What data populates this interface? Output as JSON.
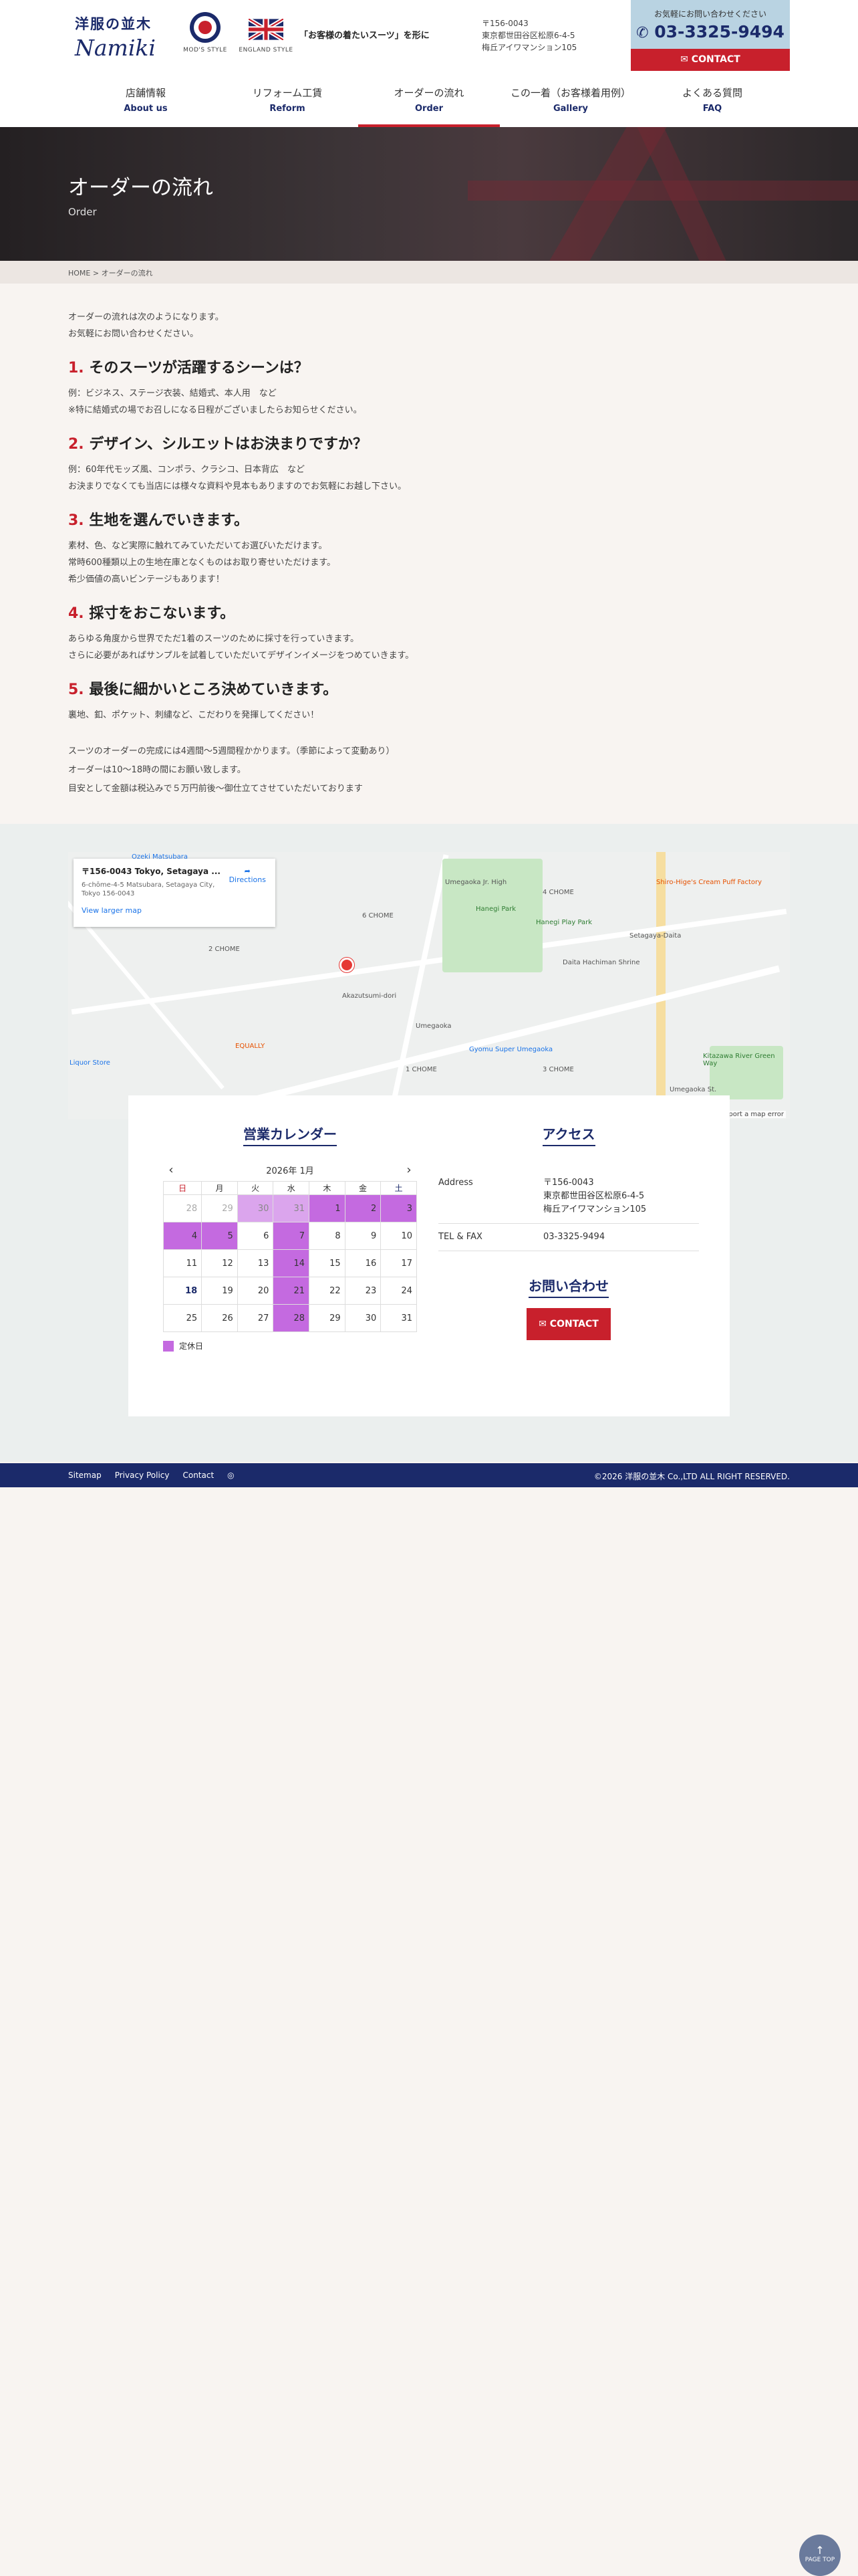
{
  "header": {
    "logo_jp": "洋服の並木",
    "logo_en": "Namiki",
    "mods_caption": "MOD'S STYLE",
    "england_caption": "ENGLAND STYLE",
    "tagline": "「お客様の着たいスーツ」を形に",
    "address_lines": [
      "〒156-0043",
      "東京都世田谷区松原6-4-5",
      "梅丘アイワマンション105"
    ],
    "contact_label": "お気軽にお問い合わせください",
    "phone": "03-3325-9494",
    "contact_button": "CONTACT"
  },
  "nav": [
    {
      "jp": "店舗情報",
      "en": "About us"
    },
    {
      "jp": "リフォーム工賃",
      "en": "Reform"
    },
    {
      "jp": "オーダーの流れ",
      "en": "Order"
    },
    {
      "jp": "この一着（お客様着用例）",
      "en": "Gallery"
    },
    {
      "jp": "よくある質問",
      "en": "FAQ"
    }
  ],
  "hero": {
    "title": "オーダーの流れ",
    "subtitle": "Order"
  },
  "breadcrumb": "HOME > オーダーの流れ",
  "intro": [
    "オーダーの流れは次のようになります。",
    "お気軽にお問い合わせください。"
  ],
  "steps": [
    {
      "num": "1.",
      "title": "そのスーツが活躍するシーンは？",
      "lines": [
        "例：ビジネス、ステージ衣装、結婚式、本人用　など",
        "※特に結婚式の場でお召しになる日程がございましたらお知らせください。"
      ]
    },
    {
      "num": "2.",
      "title": "デザイン、シルエットはお決まりですか？",
      "lines": [
        "例：60年代モッズ風、コンポラ、クラシコ、日本背広　など",
        "お決まりでなくても当店には様々な資料や見本もありますのでお気軽にお越し下さい。"
      ]
    },
    {
      "num": "3.",
      "title": "生地を選んでいきます。",
      "lines": [
        "素材、色、など実際に触れてみていただいてお選びいただけます。",
        "常時600種類以上の生地在庫となくものはお取り寄せいただけます。",
        "希少価値の高いビンテージもあります！"
      ]
    },
    {
      "num": "4.",
      "title": "採寸をおこないます。",
      "lines": [
        "あらゆる角度から世界でただ1着のスーツのために採寸を行っていきます。",
        "さらに必要があればサンプルを試着していただいてデザインイメージをつめていきます。"
      ]
    },
    {
      "num": "5.",
      "title": "最後に細かいところ決めていきます。",
      "lines": [
        "裏地、釦、ポケット、刺繍など、こだわりを発揮してください！"
      ]
    }
  ],
  "notes": [
    "スーツのオーダーの完成には4週間〜5週間程かかります。（季節によって変動あり）",
    "オーダーは10〜18時の間にお願い致します。",
    "目安として金額は税込みで５万円前後〜御仕立てさせていただいております"
  ],
  "map": {
    "card_title": "〒156-0043 Tokyo, Setagaya ...",
    "card_addr": "6-chōme-4-5 Matsubara, Setagaya City, Tokyo 156-0043",
    "directions": "Directions",
    "larger": "View larger map",
    "report": "Report a map error",
    "labels": [
      "Umegaoka Jr. High",
      "Hanegi Park",
      "Hanegi Play Park",
      "Setagaya-Daita",
      "Shiro-Hige's Cream Puff Factory",
      "Daita Hachiman Shrine",
      "Akazutsumi-dori",
      "Umegaoka",
      "Gyomu Super Umegaoka",
      "Kitazawa River Green Way",
      "EQUALLY",
      "Liquor Store",
      "Umegaoka St.",
      "6 CHOME",
      "2 CHOME",
      "4 CHOME",
      "1 CHOME",
      "3 CHOME",
      "Ozeki Matsubara"
    ]
  },
  "calendar": {
    "title": "営業カレンダー",
    "month": "2026年 1月",
    "weekdays": [
      "日",
      "月",
      "火",
      "水",
      "木",
      "金",
      "土"
    ],
    "weeks": [
      [
        {
          "d": "28",
          "o": true,
          "c": false
        },
        {
          "d": "29",
          "o": true,
          "c": false
        },
        {
          "d": "30",
          "o": true,
          "c": true
        },
        {
          "d": "31",
          "o": true,
          "c": true
        },
        {
          "d": "1",
          "o": false,
          "c": true
        },
        {
          "d": "2",
          "o": false,
          "c": true
        },
        {
          "d": "3",
          "o": false,
          "c": true
        }
      ],
      [
        {
          "d": "4",
          "o": false,
          "c": true
        },
        {
          "d": "5",
          "o": false,
          "c": true
        },
        {
          "d": "6",
          "o": false,
          "c": false
        },
        {
          "d": "7",
          "o": false,
          "c": true
        },
        {
          "d": "8",
          "o": false,
          "c": false
        },
        {
          "d": "9",
          "o": false,
          "c": false
        },
        {
          "d": "10",
          "o": false,
          "c": false
        }
      ],
      [
        {
          "d": "11",
          "o": false,
          "c": false
        },
        {
          "d": "12",
          "o": false,
          "c": false
        },
        {
          "d": "13",
          "o": false,
          "c": false
        },
        {
          "d": "14",
          "o": false,
          "c": true
        },
        {
          "d": "15",
          "o": false,
          "c": false
        },
        {
          "d": "16",
          "o": false,
          "c": false
        },
        {
          "d": "17",
          "o": false,
          "c": false
        }
      ],
      [
        {
          "d": "18",
          "o": false,
          "c": false,
          "t": true
        },
        {
          "d": "19",
          "o": false,
          "c": false
        },
        {
          "d": "20",
          "o": false,
          "c": false
        },
        {
          "d": "21",
          "o": false,
          "c": true
        },
        {
          "d": "22",
          "o": false,
          "c": false
        },
        {
          "d": "23",
          "o": false,
          "c": false
        },
        {
          "d": "24",
          "o": false,
          "c": false
        }
      ],
      [
        {
          "d": "25",
          "o": false,
          "c": false
        },
        {
          "d": "26",
          "o": false,
          "c": false
        },
        {
          "d": "27",
          "o": false,
          "c": false
        },
        {
          "d": "28",
          "o": false,
          "c": true
        },
        {
          "d": "29",
          "o": false,
          "c": false
        },
        {
          "d": "30",
          "o": false,
          "c": false
        },
        {
          "d": "31",
          "o": false,
          "c": false
        }
      ]
    ],
    "legend": "定休日",
    "closed_color": "#c46ae0"
  },
  "access": {
    "title": "アクセス",
    "address_label": "Address",
    "address_lines": [
      "〒156-0043",
      "東京都世田谷区松原6-4-5",
      "梅丘アイワマンション105"
    ],
    "tel_label": "TEL & FAX",
    "tel": "03-3325-9494",
    "inquiry_title": "お問い合わせ",
    "contact_button": "CONTACT"
  },
  "footer": {
    "links": [
      "Sitemap",
      "Privacy Policy",
      "Contact"
    ],
    "copyright": "©2026 洋服の並木 Co.,LTD ALL RIGHT RESERVED."
  },
  "pagetop": "PAGE TOP",
  "colors": {
    "navy": "#1b2a6a",
    "red": "#c8202c",
    "light_blue": "#b9d3e2"
  }
}
